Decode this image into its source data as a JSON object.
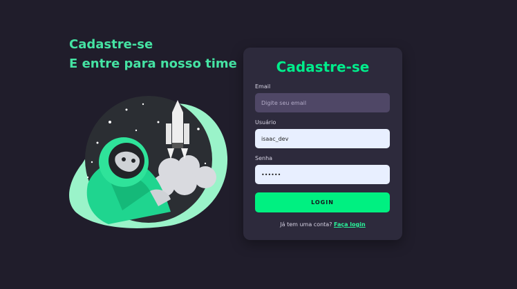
{
  "hero": {
    "line1": "Cadastre-se",
    "line2": "E entre para nosso time"
  },
  "form": {
    "title": "Cadastre-se",
    "email_label": "Email",
    "email_placeholder": "Digite seu email",
    "email_value": "",
    "user_label": "Usuário",
    "user_value": "isaac_dev",
    "pass_label": "Senha",
    "pass_value": "123456",
    "submit_label": "LOGIN",
    "footer_text": "Já tem uma conta?",
    "footer_link": "Faça login"
  },
  "illustration": {
    "icon": "astronaut-rocket-icon"
  },
  "colors": {
    "background": "#201d2b",
    "card": "#2d2a3c",
    "accent": "#00f081",
    "hero_text": "#45e3a3"
  }
}
